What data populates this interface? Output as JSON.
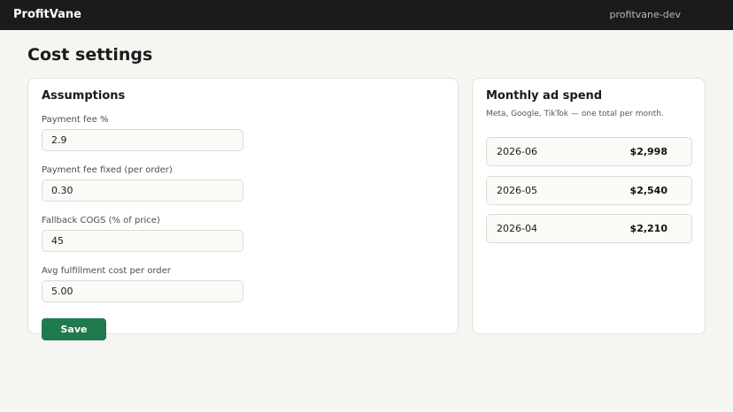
{
  "header": {
    "brand": "ProfitVane",
    "workspace": "profitvane-dev"
  },
  "page": {
    "title": "Cost settings"
  },
  "assumptions": {
    "title": "Assumptions",
    "fields": [
      {
        "label": "Payment fee %",
        "value": "2.9"
      },
      {
        "label": "Payment fee fixed (per order)",
        "value": "0.30"
      },
      {
        "label": "Fallback COGS (% of price)",
        "value": "45"
      },
      {
        "label": "Avg fulfillment cost per order",
        "value": "5.00"
      }
    ],
    "save_label": "Save"
  },
  "ad_spend": {
    "title": "Monthly ad spend",
    "subtitle": "Meta, Google, TikTok — one total per month.",
    "rows": [
      {
        "month": "2026-06",
        "amount": "$2,998"
      },
      {
        "month": "2026-05",
        "amount": "$2,540"
      },
      {
        "month": "2026-04",
        "amount": "$2,210"
      }
    ]
  },
  "colors": {
    "topbar": "#1b1b1b",
    "background": "#f5f5f2",
    "accent": "#1f7a4d"
  }
}
